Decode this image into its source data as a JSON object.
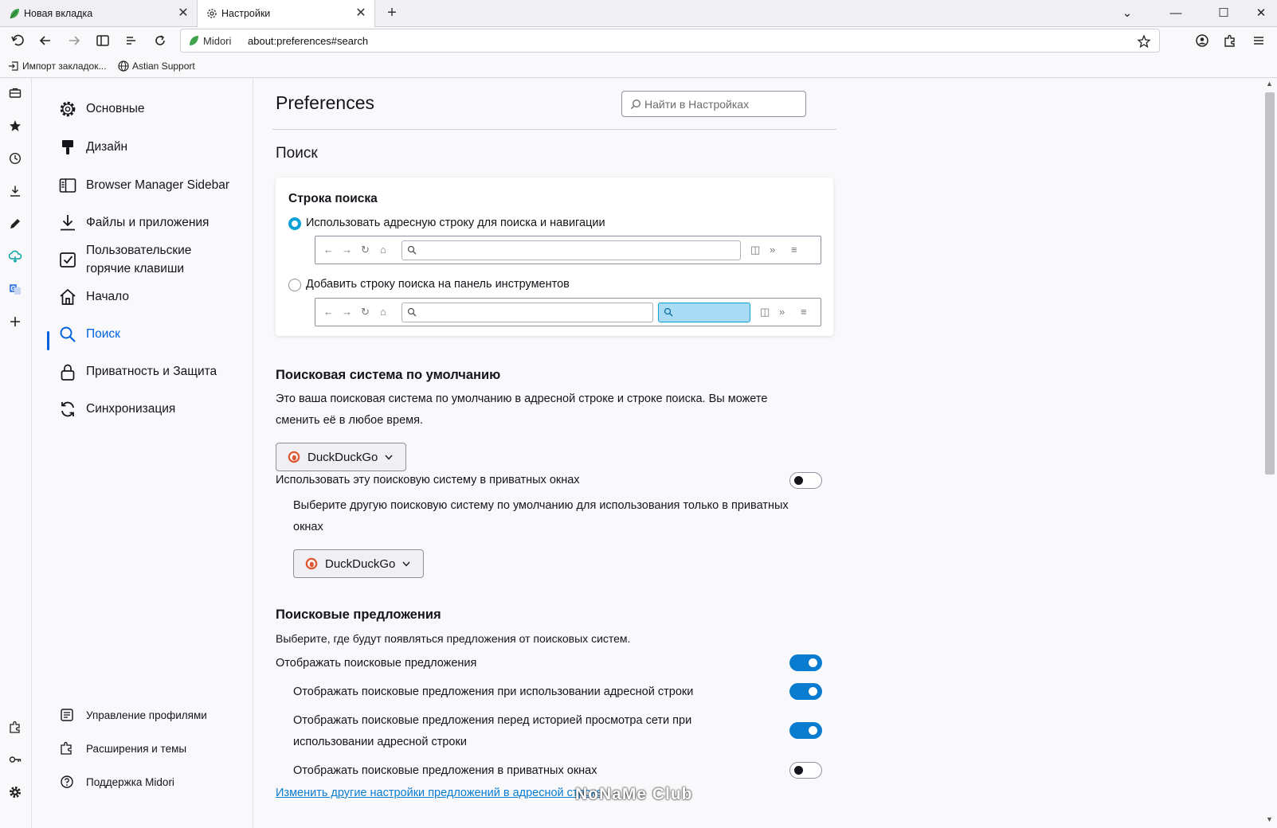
{
  "tabs": [
    {
      "title": "Новая вкладка",
      "icon": "midori-leaf-icon"
    },
    {
      "title": "Настройки",
      "icon": "gear-icon",
      "active": true
    }
  ],
  "navbar": {
    "site_label": "Midori",
    "url": "about:preferences#search"
  },
  "bookmarks": [
    {
      "label": "Импорт закладок...",
      "icon": "import-icon"
    },
    {
      "label": "Astian Support",
      "icon": "globe-icon"
    }
  ],
  "categories": [
    {
      "label": "Основные",
      "icon": "gear-icon"
    },
    {
      "label": "Дизайн",
      "icon": "paintbrush-icon"
    },
    {
      "label": "Browser Manager Sidebar",
      "icon": "sidebar-icon"
    },
    {
      "label": "Файлы и приложения",
      "icon": "download-icon"
    },
    {
      "label": "Пользовательские горячие клавиши",
      "icon": "checkbox-icon"
    },
    {
      "label": "Начало",
      "icon": "home-icon"
    },
    {
      "label": "Поиск",
      "icon": "search-icon",
      "selected": true
    },
    {
      "label": "Приватность и Защита",
      "icon": "lock-icon"
    },
    {
      "label": "Синхронизация",
      "icon": "sync-icon"
    }
  ],
  "footer_links": [
    {
      "label": "Управление профилями",
      "icon": "profile-icon"
    },
    {
      "label": "Расширения и темы",
      "icon": "puzzle-icon"
    },
    {
      "label": "Поддержка Midori",
      "icon": "help-icon"
    }
  ],
  "page": {
    "title": "Preferences",
    "search_placeholder": "Найти в Настройках",
    "section_title": "Поиск"
  },
  "search_bar_card": {
    "title": "Строка поиска",
    "option1": "Использовать адресную строку для поиска и навигации",
    "option2": "Добавить строку поиска на панель инструментов",
    "selected_option": 1
  },
  "default_engine": {
    "title": "Поисковая система по умолчанию",
    "description_line1": "Это ваша поисковая система по умолчанию в адресной строке и строке поиска. Вы можете",
    "description_line2": "сменить её в любое время.",
    "engine": "DuckDuckGo",
    "private_toggle_label": "Использовать эту поисковую систему в приватных окнах",
    "private_toggle_on": false,
    "private_desc_line1": "Выберите другую поисковую систему по умолчанию для использования только в приватных",
    "private_desc_line2": "окнах",
    "private_engine": "DuckDuckGo"
  },
  "suggestions": {
    "title": "Поисковые предложения",
    "description": "Выберите, где будут появляться предложения от поисковых систем.",
    "items": [
      {
        "label": "Отображать поисковые предложения",
        "on": true
      },
      {
        "label": "Отображать поисковые предложения при использовании адресной строки",
        "on": true
      },
      {
        "label_line1": "Отображать поисковые предложения перед историей просмотра сети при",
        "label_line2": "использовании адресной строки",
        "on": true
      },
      {
        "label": "Отображать поисковые предложения в приватных окнах",
        "on": false
      }
    ],
    "link": "Изменить другие настройки предложений в адресной строке"
  },
  "watermark": "NoNaMe Club",
  "colors": {
    "accent": "#0061e0",
    "toggle_on": "#0a7ccf",
    "radio_on": "#0aa1d4",
    "link": "#0a7ccf"
  }
}
